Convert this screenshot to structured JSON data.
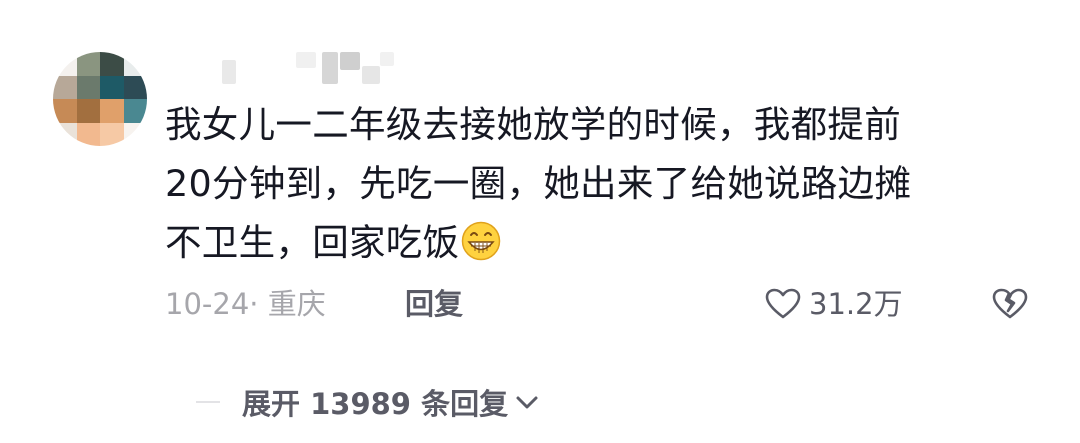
{
  "comment": {
    "lines": [
      "我女儿一二年级去接她放学的时候，我都提前",
      "20分钟到，先吃一圈，她出来了给她说路边摊",
      "不卫生，回家吃饭"
    ],
    "emoji": "grinning-face-icon"
  },
  "meta": {
    "date_location": "10-24· 重庆",
    "reply_label": "回复",
    "like_count": "31.2万"
  },
  "replies": {
    "expand_label": "展开 13989 条回复"
  },
  "colors": {
    "primary_text": "#161823",
    "secondary_text": "#a6a6ab",
    "action_text": "#5a5b66"
  }
}
